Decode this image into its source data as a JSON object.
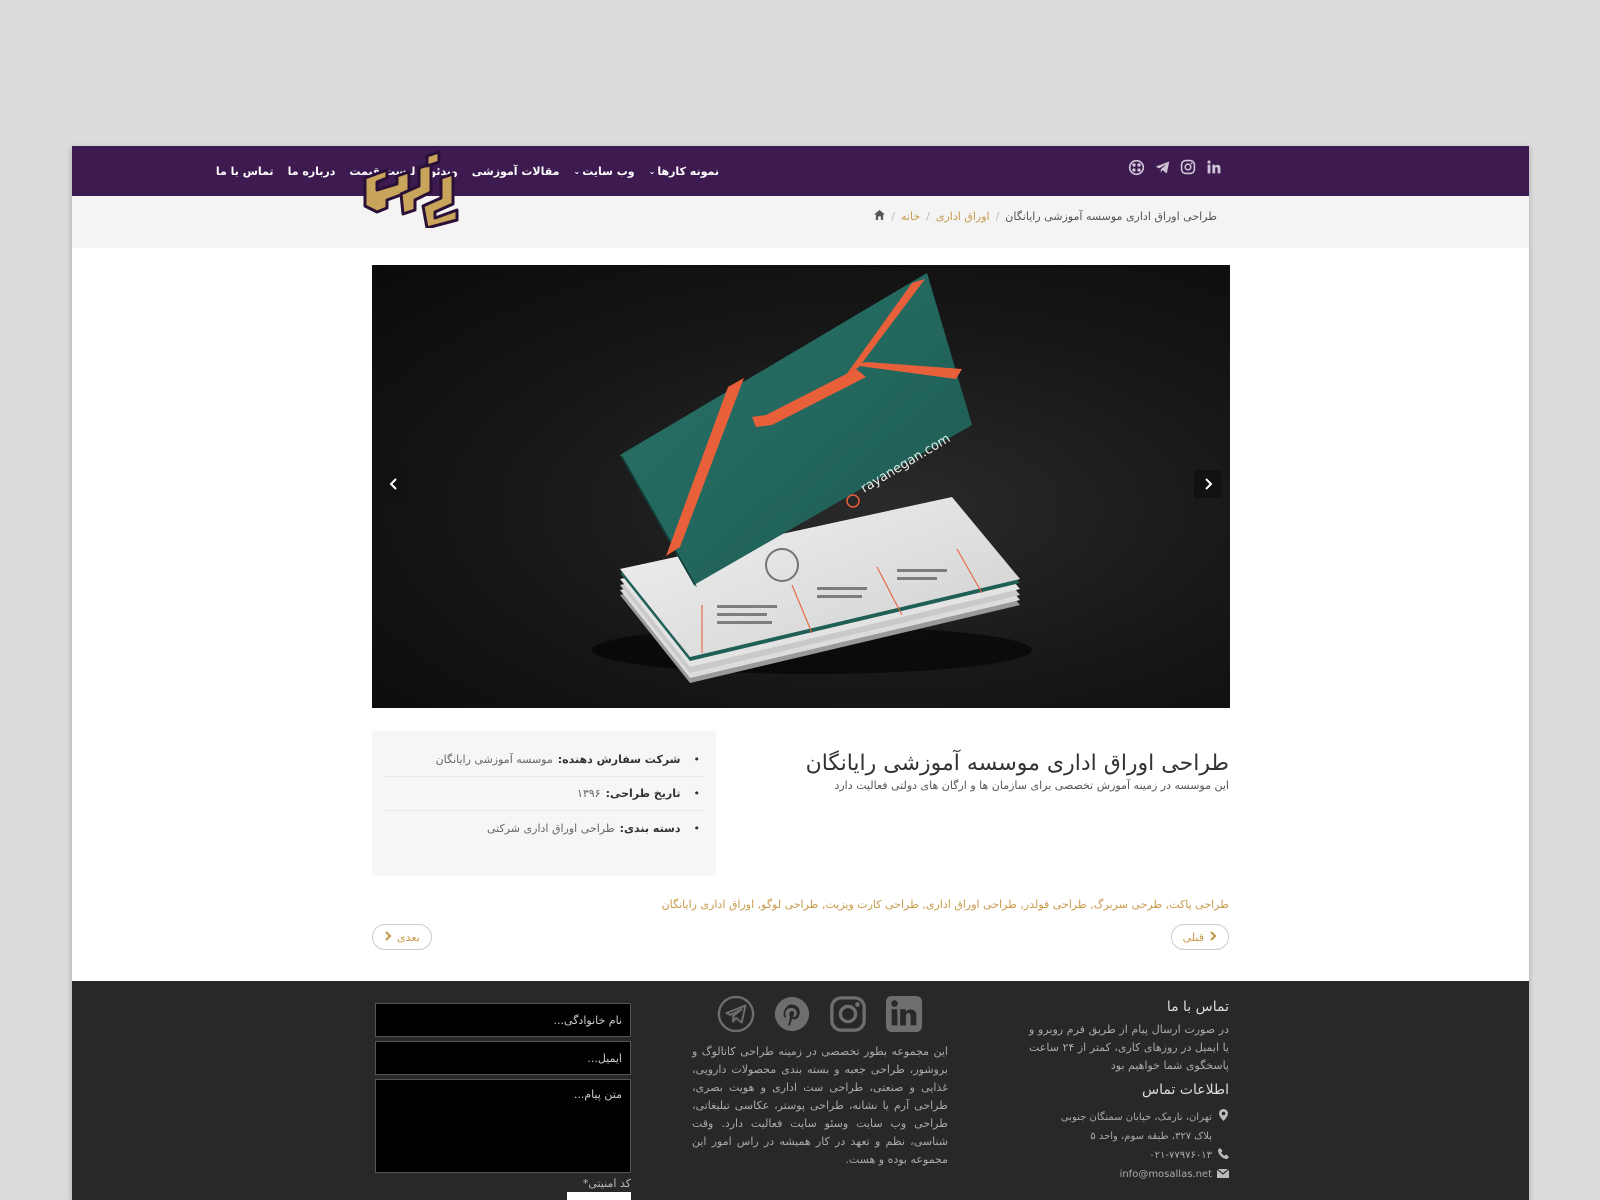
{
  "nav": {
    "items": [
      {
        "label": "تماس با ما",
        "dropdown": false
      },
      {
        "label": "درباره ما",
        "dropdown": false
      },
      {
        "label": "لیست قیمت",
        "dropdown": false
      },
      {
        "label": "ویدئو",
        "dropdown": false
      },
      {
        "label": "مقالات آموزشی",
        "dropdown": false
      },
      {
        "label": "وب سایت",
        "dropdown": true
      },
      {
        "label": "نمونه کارها",
        "dropdown": true
      }
    ],
    "social": [
      "linkedin-icon",
      "instagram-icon",
      "telegram-icon",
      "aparat-icon"
    ]
  },
  "breadcrumb": {
    "home": "خانه",
    "category": "اوراق اداری",
    "current": "طراحی اوراق اداری موسسه آموزشی رایانگان"
  },
  "slider": {
    "card_text": "rayanegan.com",
    "prev_icon": "chevron-left-icon",
    "next_icon": "chevron-right-icon"
  },
  "project": {
    "title": "طراحی اوراق اداری موسسه آموزشی رایانگان",
    "description": "این موسسه در زمینه آموزش تخصصی برای سازمان ها و ارگان های دولتی فعالیت دارد",
    "info": [
      {
        "label": "شرکت سفارش دهنده:",
        "value": "موسسه آموزشی رایانگان"
      },
      {
        "label": "تاریخ طراحی:",
        "value": "۱۳۹۶"
      },
      {
        "label": "دسته بندی:",
        "value": "طراحی اوراق اداری شرکتی"
      }
    ],
    "tags": [
      "طراحی پاکت",
      "طرحی سربرگ",
      "طراحی فولدر",
      "طراحی اوراق اداری",
      "طراحی کارت ویزیت",
      "طراحی لوگو",
      "اوراق اداری رایانگان"
    ]
  },
  "pager": {
    "prev_label": "قبلی",
    "next_label": "بعدی"
  },
  "footer": {
    "contact_title": "تماس با ما",
    "contact_text": "در صورت ارسال پیام از طریق فرم روبرو و یا ایمیل در روزهای کاری، کمتر از ۲۴ ساعت پاسخگوی شما خواهیم بود",
    "info_title": "اطلاعات تماس",
    "address_line1": "تهران، نارمک، خیابان سمنگان جنوبی",
    "address_line2": "پلاک ۳۲۷، طبقه سوم، واحد ۵",
    "phone": "۰۲۱-۷۷۹۷۶۰۱۳",
    "email": "info@mosallas.net",
    "about_text": "این مجموعه بطور تخصصی در زمینه طراحی کاتالوگ و بروشور، طراحی جعبه و بسته بندی محصولات دارویی، غذایی و صنعتی، طراحی ست اداری و هویت بصری، طراحی آرم یا نشانه، طراحی پوستر، عکاسی تبلیغاتی، طراحی وب سایت وسئو سایت فعالیت دارد. وقت شناسی، نظم و تعهد در کار همیشه در راس امور این مجموعه بوده و هست.",
    "social": [
      "linkedin-icon",
      "instagram-icon",
      "pinterest-icon",
      "telegram-icon"
    ],
    "form": {
      "name_placeholder": "نام خانوادگی...",
      "email_placeholder": "ایمیل...",
      "message_placeholder": "متن پیام...",
      "captcha_label": "کد امنیتی*"
    }
  },
  "colors": {
    "nav_bg": "#3d1b50",
    "accent": "#c79a4a",
    "footer_bg": "#282828",
    "card_teal": "#23675e",
    "card_orange": "#e8603a"
  }
}
